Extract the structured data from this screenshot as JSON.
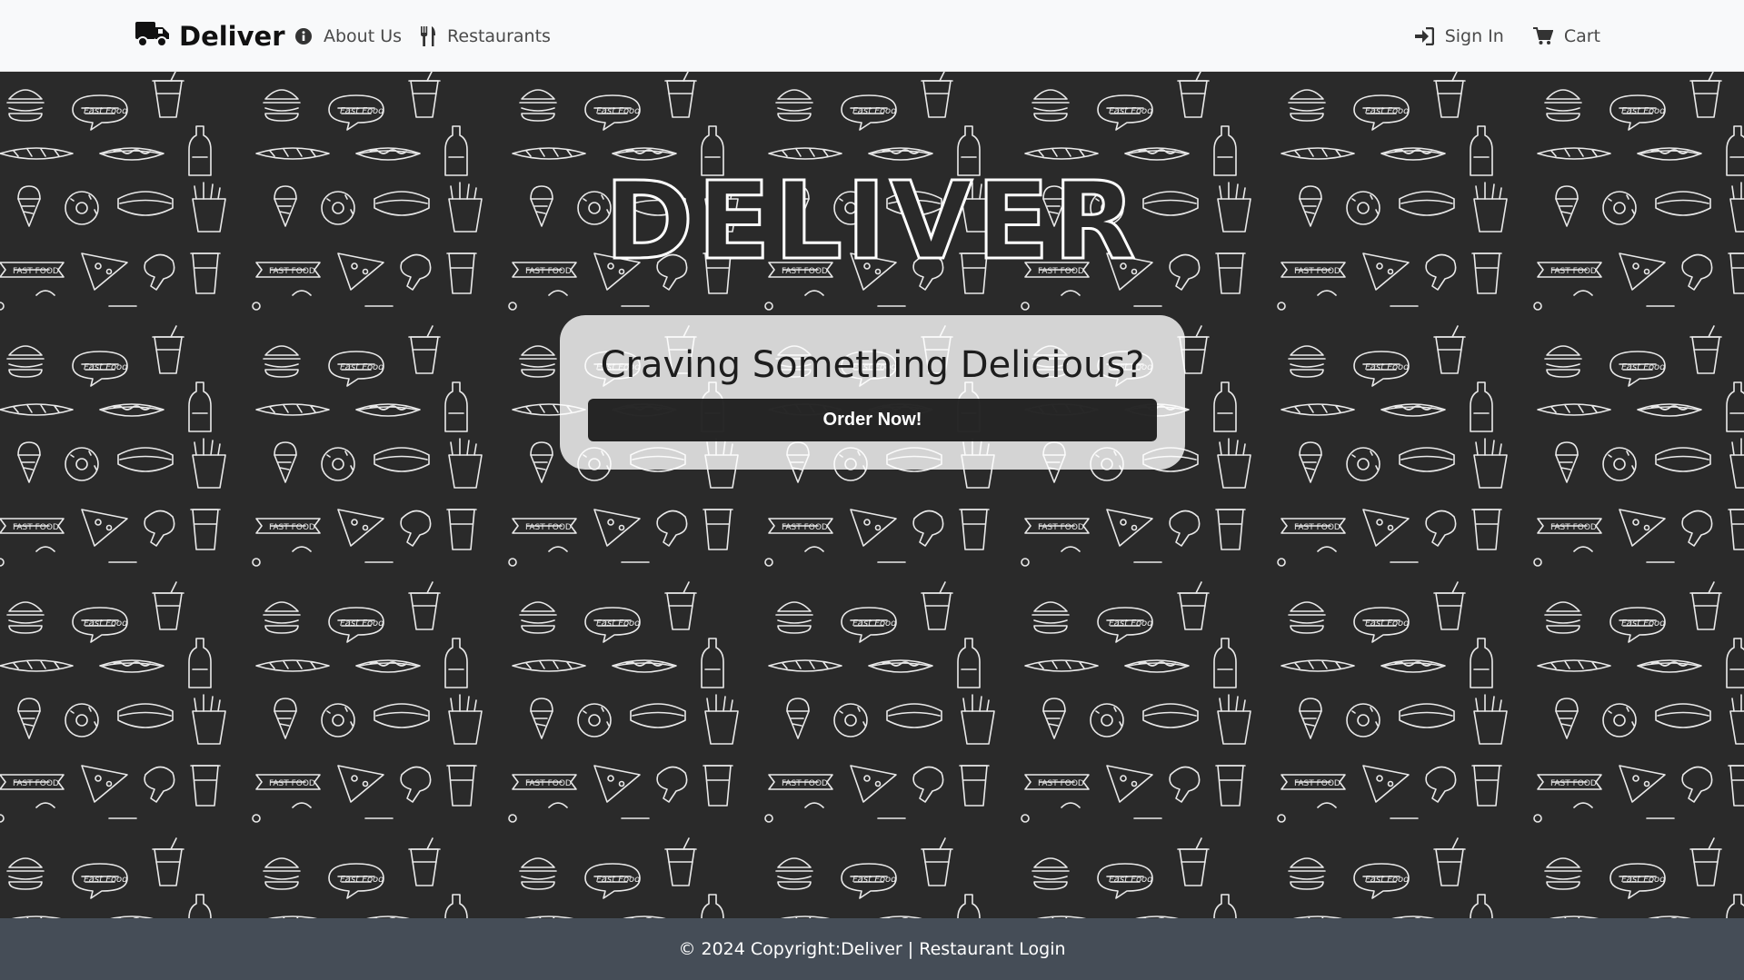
{
  "navbar": {
    "brand": "Deliver",
    "brand_icon": "truck-icon",
    "links_left": [
      {
        "label": "About Us",
        "icon": "info-circle-icon"
      },
      {
        "label": "Restaurants",
        "icon": "utensils-icon"
      }
    ],
    "links_right": [
      {
        "label": "Sign In",
        "icon": "sign-in-icon"
      },
      {
        "label": "Cart",
        "icon": "cart-icon"
      }
    ]
  },
  "hero": {
    "title": "DELIVER",
    "heading": "Craving Something Delicious?",
    "button_label": "Order Now!",
    "pattern_text": "Fast Food"
  },
  "footer": {
    "copyright": "© 2024 Copyright: ",
    "brand_link": "Deliver",
    "separator": " | ",
    "restaurant_login": "Restaurant Login"
  },
  "colors": {
    "navbar_bg": "#f8f9fa",
    "hero_bg": "#2a2a2a",
    "footer_bg": "#454d57",
    "button_bg": "#161616"
  }
}
